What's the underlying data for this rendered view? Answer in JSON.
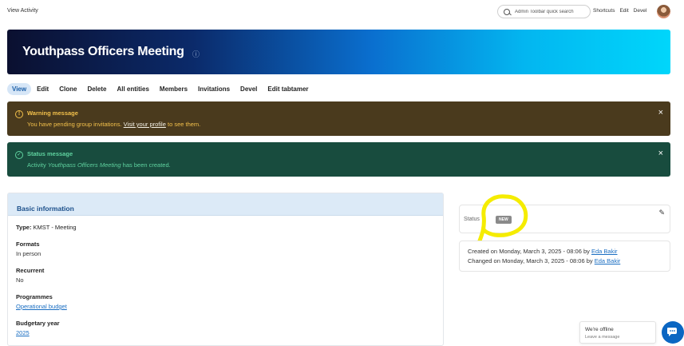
{
  "toolbar": {
    "left_link": "View Activity",
    "search_placeholder": "Admin Toolbar quick search",
    "links": [
      "Shortcuts",
      "Edit",
      "Devel"
    ]
  },
  "hero": {
    "title": "Youthpass Officers Meeting"
  },
  "tabs": [
    "View",
    "Edit",
    "Clone",
    "Delete",
    "All entities",
    "Members",
    "Invitations",
    "Devel",
    "Edit tabtamer"
  ],
  "active_tab": "View",
  "warning": {
    "title": "Warning message",
    "text_before": "You have pending group invitations.",
    "link": "Visit your profile",
    "text_after": "to see them.",
    "close": "×"
  },
  "status_msg": {
    "title": "Status message",
    "text_before": "Activity",
    "entity": "Youthpass Officers Meeting",
    "text_after": "has been created.",
    "close": "×"
  },
  "basic_info": {
    "heading": "Basic information",
    "type_label": "Type:",
    "type_value": "KMST - Meeting",
    "formats_label": "Formats",
    "formats_value": "In person",
    "recurrent_label": "Recurrent",
    "recurrent_value": "No",
    "programmes_label": "Programmes",
    "programmes_value": "Operational budget",
    "budgetary_label": "Budgetary year",
    "budgetary_value": "2025"
  },
  "status_box": {
    "label": "Status",
    "badge": "NEW"
  },
  "meta": {
    "created_prefix": "Created on Monday, March 3, 2025 - 08:06 by",
    "created_user": "Eda Bakir",
    "changed_prefix": "Changed on Monday, March 3, 2025 - 08:06 by",
    "changed_user": "Eda Bakir"
  },
  "chat": {
    "title": "We're offline",
    "subtitle": "Leave a message"
  },
  "colors": {
    "highlight": "#f5ec00",
    "accent": "#1a6ec2",
    "warning_bg": "#4a3a1d",
    "status_bg": "#184c3e"
  }
}
